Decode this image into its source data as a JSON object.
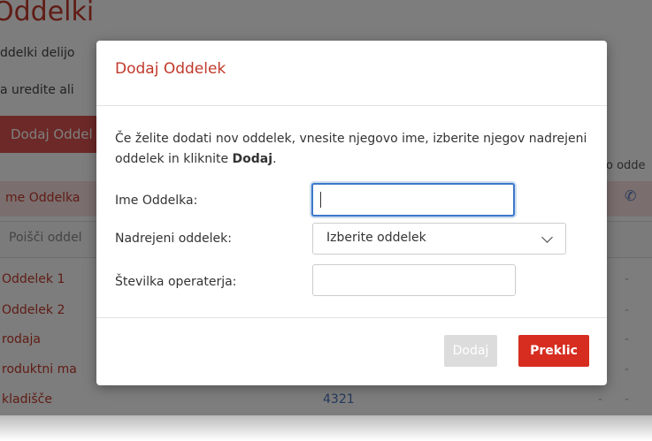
{
  "background": {
    "title": "Oddelki",
    "subtitle1": "ddelki delijo",
    "subtitle2": "a uredite ali",
    "add_button": "Dodaj Oddel",
    "table_header": "me Oddelka",
    "header_right": "o odde",
    "search_placeholder": "Poišči oddel",
    "rows": [
      {
        "name": "Oddelek 1",
        "number": "",
        "d1": "-",
        "d2": "-"
      },
      {
        "name": "Oddelek 2",
        "number": "",
        "d1": "",
        "d2": "-"
      },
      {
        "name": "rodaja",
        "number": "",
        "d1": "",
        "d2": "-"
      },
      {
        "name": "roduktni ma",
        "number": "",
        "d1": "",
        "d2": "-"
      },
      {
        "name": "kladišče",
        "number": "4321",
        "d1": "-",
        "d2": "-"
      }
    ]
  },
  "modal": {
    "title": "Dodaj Oddelek",
    "description_part1": "Če želite dodati nov oddelek, vnesite njegovo ime, izberite njegov nadrejeni oddelek in kliknite ",
    "description_bold": "Dodaj",
    "description_end": ".",
    "name_label": "Ime Oddelka:",
    "name_value": "",
    "parent_label": "Nadrejeni oddelek:",
    "parent_selected": "Izberite oddelek",
    "operator_label": "Številka operaterja:",
    "operator_value": "",
    "add_button": "Dodaj",
    "cancel_button": "Preklic"
  },
  "colors": {
    "accent": "#c0392b",
    "cancel": "#d62d20",
    "focus": "#3b78c9"
  }
}
